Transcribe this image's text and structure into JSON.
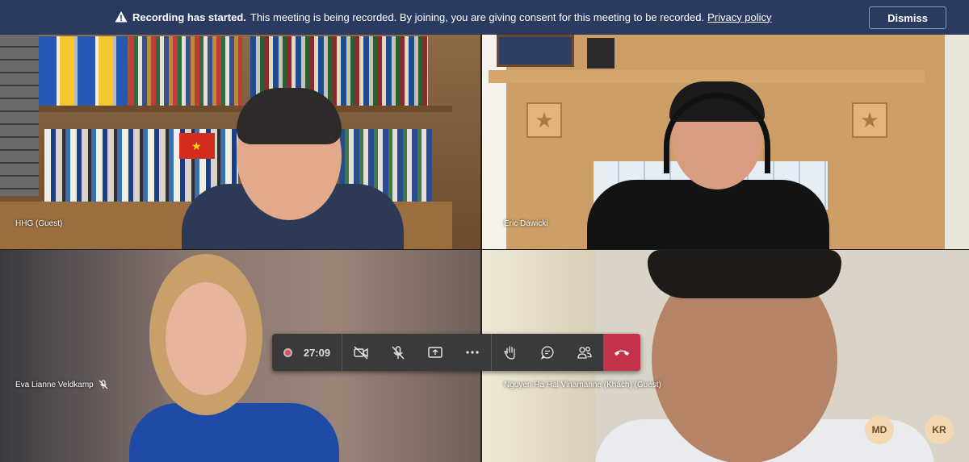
{
  "banner": {
    "title": "Recording has started.",
    "message": "This meeting is being recorded. By joining, you are giving consent for this meeting to be recorded.",
    "link": "Privacy policy",
    "dismiss": "Dismiss"
  },
  "participants": [
    {
      "name": "HHG (Guest)"
    },
    {
      "name": "Eric Dawicki"
    },
    {
      "name": "Eva Lianne Veldkamp",
      "muted": true
    },
    {
      "name": "Nguyen Ha Hai Vinamarine (Khách) (Guest)"
    }
  ],
  "controls": {
    "timer": "27:09"
  },
  "avatars": [
    "MD",
    "KR"
  ],
  "colors": {
    "banner": "#2b3a60",
    "hangup": "#c4314b",
    "record": "#ef4a5b",
    "avatar_bg": "#f3d8b2"
  }
}
